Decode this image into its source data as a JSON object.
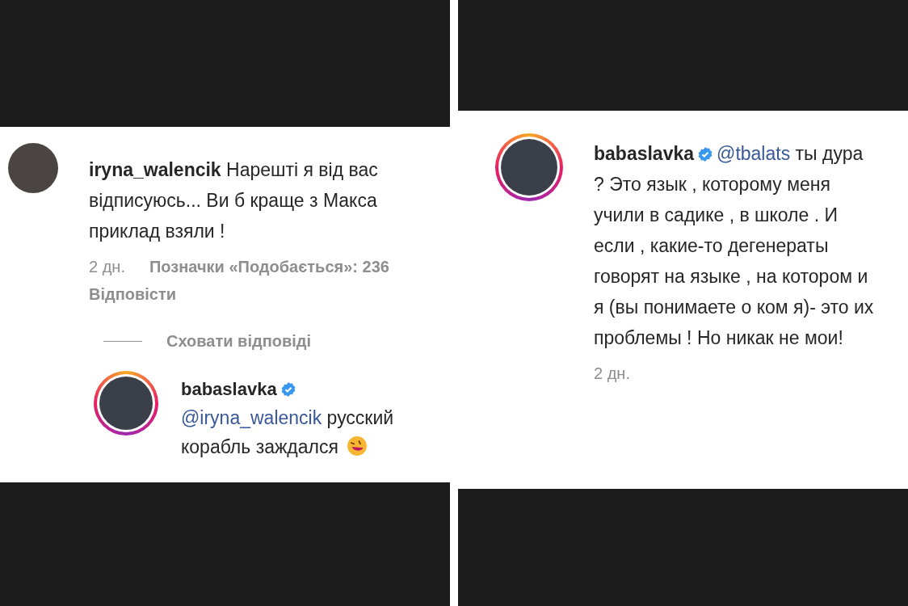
{
  "panels": [
    {
      "items": [
        {
          "kind": "comment",
          "story_ring": false,
          "username": "iryna_walencik",
          "verified": false,
          "text": "Нарешті я від вас відписуюсь... Ви б краще з Макса приклад взяли !",
          "time": "2 дн.",
          "likes": "Позначки «Подобається»: 236",
          "reply_label": "Відповісти"
        },
        {
          "kind": "toggle",
          "label": "Сховати відповіді"
        },
        {
          "kind": "reply",
          "story_ring": true,
          "username": "babaslavka",
          "verified": true,
          "mention": "@iryna_walencik",
          "text": "русский корабль заждался"
        }
      ]
    },
    {
      "items": [
        {
          "kind": "comment",
          "story_ring": true,
          "username": "babaslavka",
          "verified": true,
          "mention": "@tbalats",
          "text": "ты дура ? Это язык , которому меня учили в садике , в школе . И если , какие-то дегенераты говорят на языке , на котором и я (вы понимаете о ком я)- это их проблемы ! Но никак не мои!",
          "time": "2 дн."
        }
      ]
    }
  ]
}
